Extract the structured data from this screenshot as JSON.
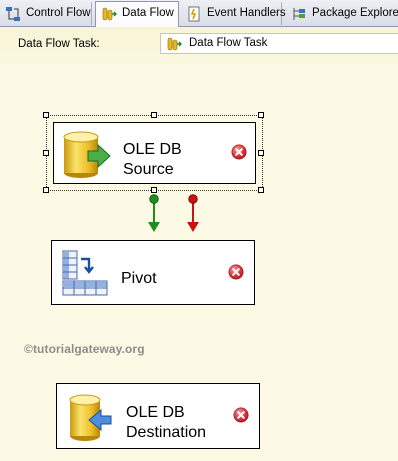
{
  "tabs": [
    {
      "label": "Control Flow",
      "icon": "control-flow-icon",
      "active": false
    },
    {
      "label": "Data Flow",
      "icon": "data-flow-icon",
      "active": true
    },
    {
      "label": "Event Handlers",
      "icon": "event-handlers-icon",
      "active": false
    },
    {
      "label": "Package Explorer",
      "icon": "package-explorer-icon",
      "active": false
    }
  ],
  "task_selector": {
    "label": "Data Flow Task:",
    "value": "Data Flow Task",
    "icon": "data-flow-task-icon"
  },
  "components": {
    "source": {
      "line1": "OLE DB",
      "line2": "Source",
      "icon": "ole-db-source-icon",
      "status": "error",
      "selected": true
    },
    "pivot": {
      "label": "Pivot",
      "icon": "pivot-transform-icon",
      "status": "error"
    },
    "destination": {
      "line1": "OLE DB",
      "line2": "Destination",
      "icon": "ole-db-destination-icon",
      "status": "error"
    }
  },
  "paths": [
    {
      "type": "success",
      "color": "#1e8f1e"
    },
    {
      "type": "error",
      "color": "#cc1010"
    }
  ],
  "watermark": "©tutorialgateway.org",
  "colors": {
    "canvas": "#fcf9e4",
    "error_badge": "#d9363e"
  }
}
